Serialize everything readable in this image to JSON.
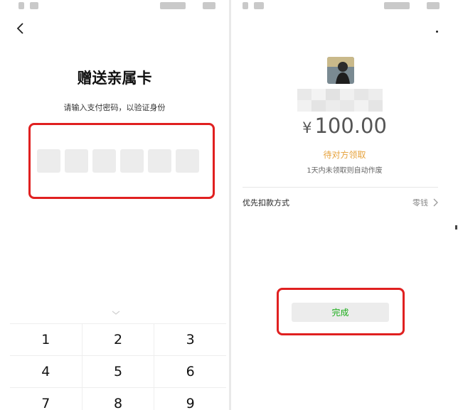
{
  "left": {
    "title": "赠送亲属卡",
    "subtitle": "请输入支付密码，以验证身份",
    "pin_boxes": 6,
    "keypad": [
      [
        "1",
        "2",
        "3"
      ],
      [
        "4",
        "5",
        "6"
      ],
      [
        "7",
        "8",
        "9"
      ]
    ]
  },
  "right": {
    "amount_currency": "¥",
    "amount_value": "100.00",
    "status": "待对方领取",
    "hint": "1天内未领取则自动作废",
    "payment_label": "优先扣款方式",
    "payment_value": "零钱",
    "done_label": "完成"
  },
  "colors": {
    "highlight": "#e02020",
    "status_orange": "#e6a23c",
    "done_green": "#1aad19"
  }
}
